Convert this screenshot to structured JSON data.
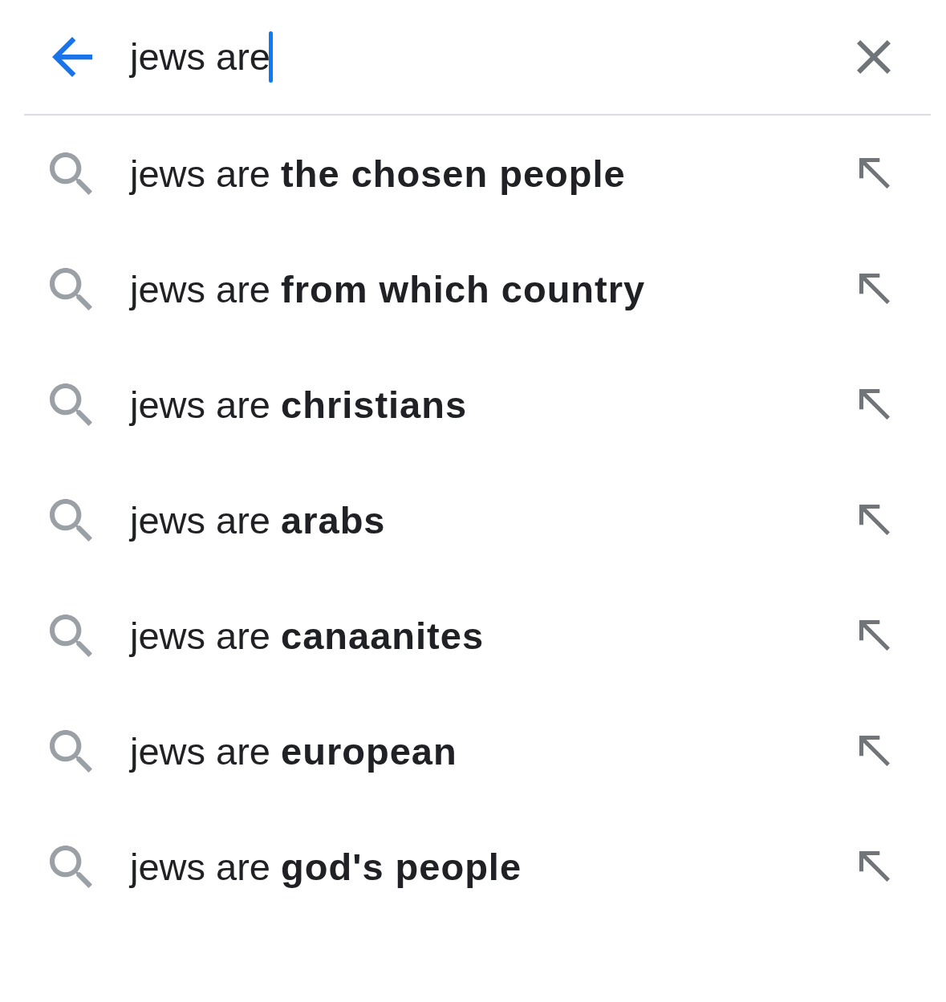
{
  "search_bar": {
    "value": "jews are",
    "focused": true
  },
  "suggestions": [
    {
      "text": "jews are **the chosen people**"
    },
    {
      "text": "jews are **from which country**"
    },
    {
      "text": "jews are **christians**"
    },
    {
      "text": "jews are **arabs**"
    },
    {
      "text": "jews are **canaanites**"
    },
    {
      "text": "jews are **european**"
    },
    {
      "text": "jews are **god's people**"
    }
  ]
}
